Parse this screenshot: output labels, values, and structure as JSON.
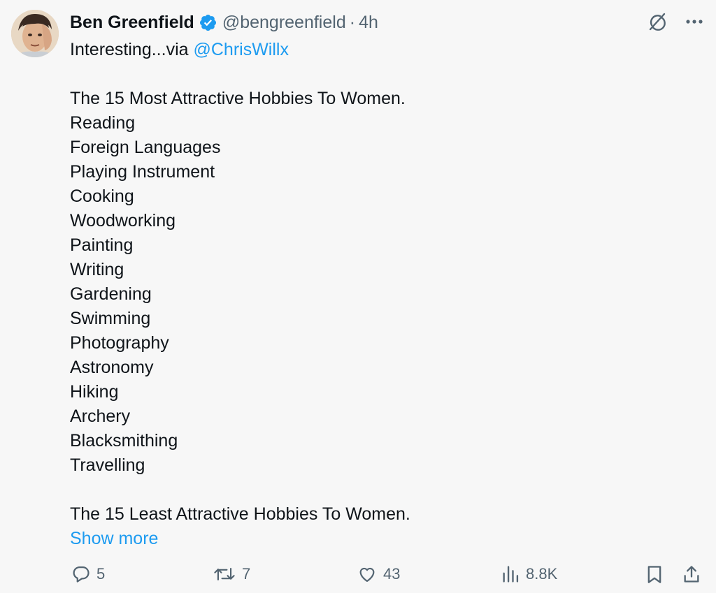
{
  "author": {
    "display_name": "Ben Greenfield",
    "handle": "@bengreenfield",
    "separator": "·",
    "time": "4h",
    "verified": true
  },
  "tweet": {
    "intro_text": "Interesting...via ",
    "mention": "@ChrisWillx",
    "most_heading": "The 15 Most Attractive Hobbies To Women.",
    "most_list": [
      "Reading",
      "Foreign Languages",
      "Playing Instrument",
      "Cooking",
      "Woodworking",
      "Painting",
      "Writing",
      "Gardening",
      "Swimming",
      "Photography",
      "Astronomy",
      "Hiking",
      "Archery",
      "Blacksmithing",
      "Travelling"
    ],
    "least_heading": "The 15 Least Attractive Hobbies To Women.",
    "show_more": "Show more"
  },
  "actions": {
    "replies": "5",
    "reposts": "7",
    "likes": "43",
    "views": "8.8K"
  },
  "icons": {
    "top_right": [
      "grok-icon",
      "more-icon"
    ],
    "actions": [
      "reply-icon",
      "repost-icon",
      "like-icon",
      "views-icon",
      "bookmark-icon",
      "share-icon"
    ]
  },
  "colors": {
    "background": "#f7f7f7",
    "text": "#0f1419",
    "secondary": "#536471",
    "accent": "#1d9bf0"
  }
}
